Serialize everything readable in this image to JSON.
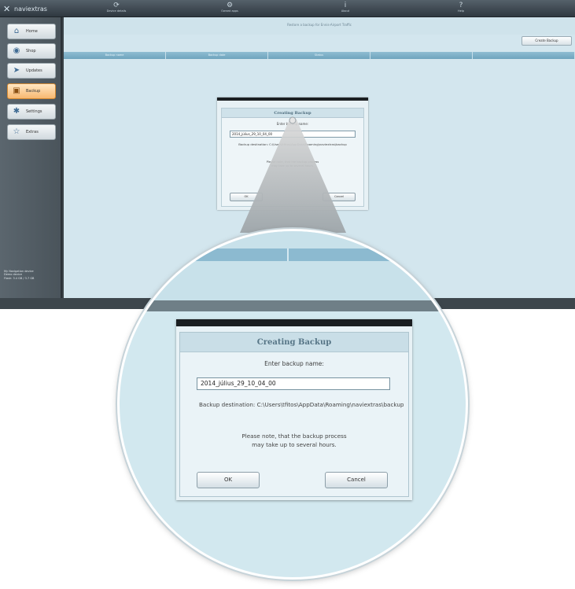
{
  "app": {
    "logo_text": "naviextras",
    "top_nav": [
      {
        "label": "Device details",
        "icon": "device-icon"
      },
      {
        "label": "Owned apps",
        "icon": "apps-icon"
      },
      {
        "label": "About",
        "icon": "info-icon"
      },
      {
        "label": "Help",
        "icon": "help-icon"
      }
    ],
    "sidebar": {
      "items": [
        {
          "label": "Home",
          "icon": "home-icon"
        },
        {
          "label": "Shop",
          "icon": "shop-icon"
        },
        {
          "label": "Updates",
          "icon": "updates-icon"
        },
        {
          "label": "Backup",
          "icon": "backup-icon",
          "active": true
        },
        {
          "label": "Settings",
          "icon": "settings-icon"
        },
        {
          "label": "Extras",
          "icon": "star-icon"
        }
      ],
      "device_info": [
        "My Navigation device",
        "Demo device",
        "Flash: 3.4 GB / 3.7 GB"
      ]
    },
    "main": {
      "subtitle": "Restore a backup for Ennis-Airport Traffic",
      "create_backup_label": "Create Backup",
      "table_headers": [
        "Backup name",
        "Backup date",
        "Status",
        "",
        ""
      ]
    }
  },
  "dialog": {
    "title": "Creating Backup",
    "prompt": "Enter backup name:",
    "backup_name": "2014_július_29_10_04_00",
    "destination": "Backup destination: C:\\Users\\tfitos\\AppData\\Roaming\\naviextras\\backup",
    "note_line1": "Please note, that the backup process",
    "note_line2": "may take up to several hours.",
    "ok_label": "OK",
    "cancel_label": "Cancel"
  },
  "colors": {
    "accent": "#f8b871",
    "dialog_title": "#567586",
    "background": "#d3e6ee"
  }
}
